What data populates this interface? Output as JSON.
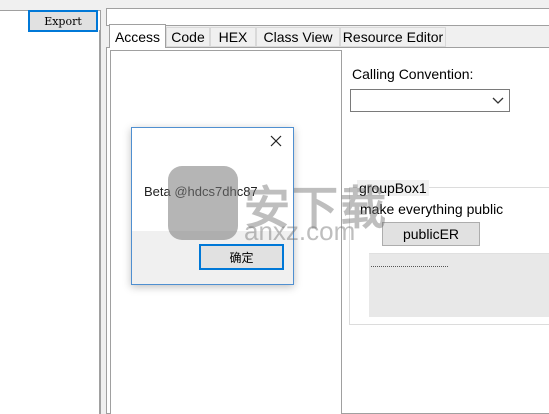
{
  "toolbar": {
    "export_label": "Export"
  },
  "tabs": [
    {
      "label": "Access"
    },
    {
      "label": "Code"
    },
    {
      "label": "HEX"
    },
    {
      "label": "Class View"
    },
    {
      "label": "Resource Editor"
    }
  ],
  "access_tab": {
    "calling_convention_label": "Calling Convention:",
    "calling_convention_value": ""
  },
  "groupbox": {
    "title": "groupBox1",
    "text": "make everything public",
    "button_label": "publicER"
  },
  "dialog": {
    "message": "Beta @hdcs7dhc87",
    "ok_label": "确定"
  },
  "watermark": {
    "text": "安下载",
    "url": "anxz.com"
  },
  "colors": {
    "accent": "#0078d7",
    "window_bg": "#f0f0f0"
  }
}
